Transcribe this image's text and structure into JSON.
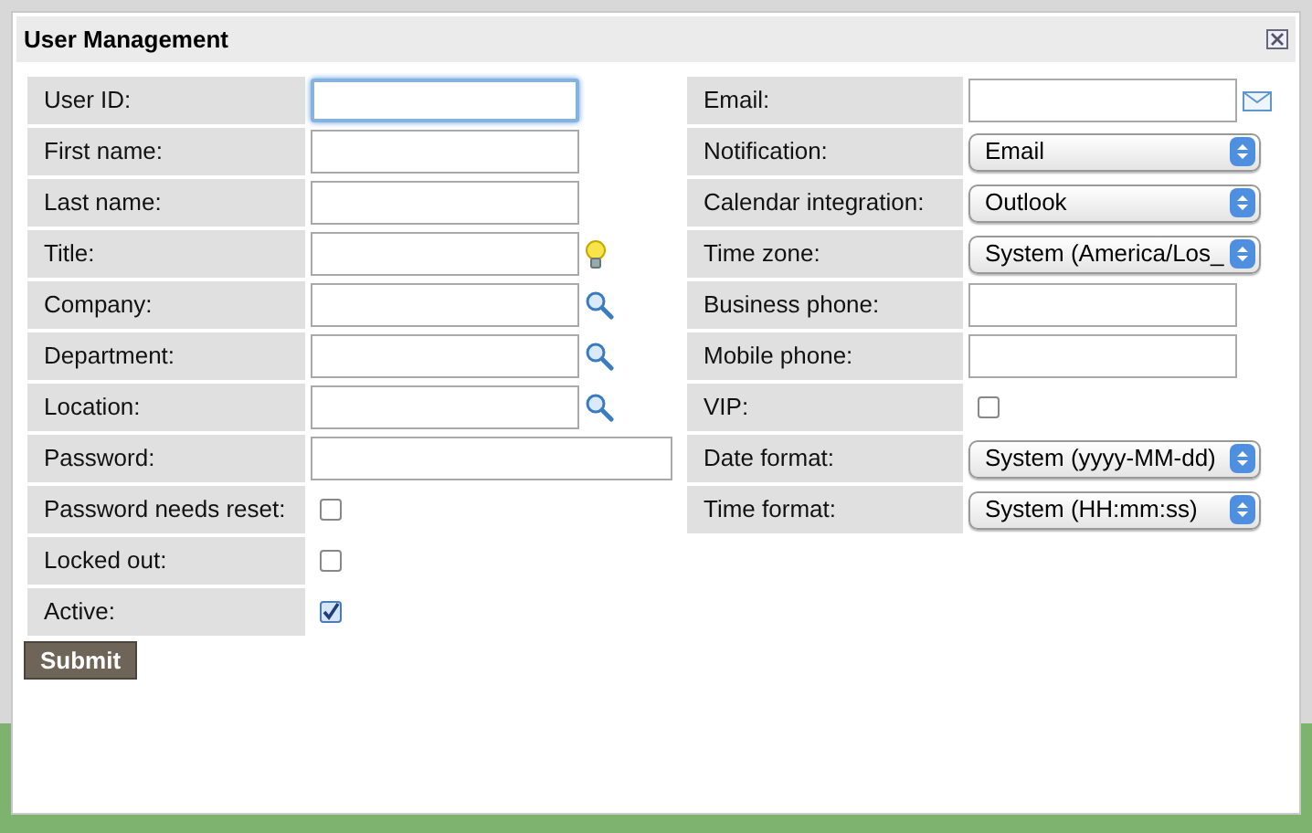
{
  "window": {
    "title": "User Management"
  },
  "left_fields": [
    {
      "label": "User ID:",
      "kind": "text",
      "focused": true
    },
    {
      "label": "First name:",
      "kind": "text"
    },
    {
      "label": "Last name:",
      "kind": "text"
    },
    {
      "label": "Title:",
      "kind": "hint"
    },
    {
      "label": "Company:",
      "kind": "lookup"
    },
    {
      "label": "Department:",
      "kind": "lookup"
    },
    {
      "label": "Location:",
      "kind": "lookup"
    },
    {
      "label": "Password:",
      "kind": "wide"
    },
    {
      "label": "Password needs reset:",
      "kind": "checkbox",
      "checked": false
    },
    {
      "label": "Locked out:",
      "kind": "checkbox",
      "checked": false
    },
    {
      "label": "Active:",
      "kind": "checkbox",
      "checked": true
    }
  ],
  "right_fields": [
    {
      "label": "Email:",
      "kind": "email"
    },
    {
      "label": "Notification:",
      "kind": "select",
      "value": "Email"
    },
    {
      "label": "Calendar integration:",
      "kind": "select",
      "value": "Outlook"
    },
    {
      "label": "Time zone:",
      "kind": "select",
      "value": "System (America/Los_"
    },
    {
      "label": "Business phone:",
      "kind": "text"
    },
    {
      "label": "Mobile phone:",
      "kind": "text"
    },
    {
      "label": "VIP:",
      "kind": "checkbox",
      "checked": false
    },
    {
      "label": "Date format:",
      "kind": "select",
      "value": "System (yyyy-MM-dd)"
    },
    {
      "label": "Time format:",
      "kind": "select",
      "value": "System (HH:mm:ss)"
    }
  ],
  "submit": "Submit"
}
